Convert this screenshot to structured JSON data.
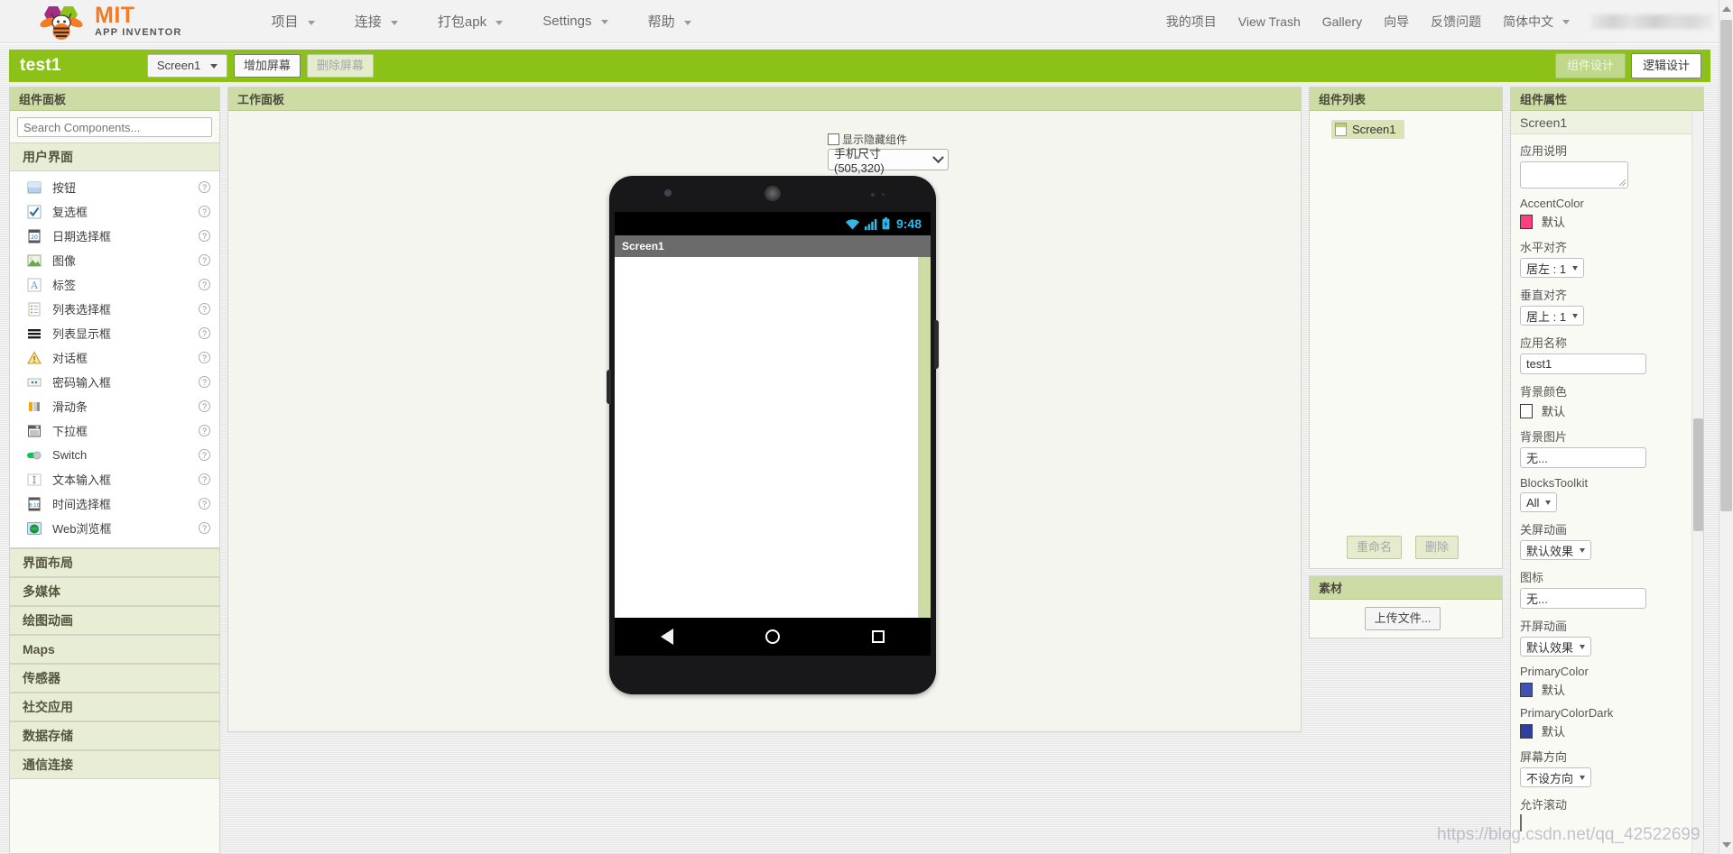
{
  "app": {
    "logo_mit": "MIT",
    "logo_subtitle": "APP INVENTOR",
    "logo_icon": "bee-logo-icon"
  },
  "topbar": {
    "menus": [
      {
        "label": "项目",
        "has_caret": true
      },
      {
        "label": "连接",
        "has_caret": true
      },
      {
        "label": "打包apk",
        "has_caret": true
      },
      {
        "label": "Settings",
        "has_caret": true
      },
      {
        "label": "帮助",
        "has_caret": true
      }
    ],
    "right_menus": [
      {
        "label": "我的项目",
        "has_caret": false
      },
      {
        "label": "View Trash",
        "has_caret": false
      },
      {
        "label": "Gallery",
        "has_caret": false
      },
      {
        "label": "向导",
        "has_caret": false
      },
      {
        "label": "反馈问题",
        "has_caret": false
      },
      {
        "label": "简体中文",
        "has_caret": true
      }
    ],
    "account_redacted": ""
  },
  "projectbar": {
    "project_name": "test1",
    "screen_selector": "Screen1",
    "add_screen": "增加屏幕",
    "remove_screen": "删除屏幕",
    "designer_toggle": "组件设计",
    "blocks_toggle": "逻辑设计",
    "active_toggle": "blocks"
  },
  "palette": {
    "header": "组件面板",
    "search_placeholder": "Search Components...",
    "search_value": "",
    "open_category": "用户界面",
    "categories": [
      {
        "label": "用户界面",
        "open": true,
        "items": [
          {
            "label": "按钮",
            "icon": "button-icon",
            "help": "?"
          },
          {
            "label": "复选框",
            "icon": "checkbox-icon",
            "help": "?"
          },
          {
            "label": "日期选择框",
            "icon": "datepicker-icon",
            "help": "?"
          },
          {
            "label": "图像",
            "icon": "image-icon",
            "help": "?"
          },
          {
            "label": "标签",
            "icon": "label-icon",
            "help": "?"
          },
          {
            "label": "列表选择框",
            "icon": "listpicker-icon",
            "help": "?"
          },
          {
            "label": "列表显示框",
            "icon": "listview-icon",
            "help": "?"
          },
          {
            "label": "对话框",
            "icon": "notifier-icon",
            "help": "?"
          },
          {
            "label": "密码输入框",
            "icon": "passwordbox-icon",
            "help": "?"
          },
          {
            "label": "滑动条",
            "icon": "slider-icon",
            "help": "?"
          },
          {
            "label": "下拉框",
            "icon": "spinner-icon",
            "help": "?"
          },
          {
            "label": "Switch",
            "icon": "switch-icon",
            "help": "?"
          },
          {
            "label": "文本输入框",
            "icon": "textbox-icon",
            "help": "?"
          },
          {
            "label": "时间选择框",
            "icon": "timepicker-icon",
            "help": "?"
          },
          {
            "label": "Web浏览框",
            "icon": "webviewer-icon",
            "help": "?"
          }
        ]
      },
      {
        "label": "界面布局",
        "open": false,
        "items": []
      },
      {
        "label": "多媒体",
        "open": false,
        "items": []
      },
      {
        "label": "绘图动画",
        "open": false,
        "items": []
      },
      {
        "label": "Maps",
        "open": false,
        "items": []
      },
      {
        "label": "传感器",
        "open": false,
        "items": []
      },
      {
        "label": "社交应用",
        "open": false,
        "items": []
      },
      {
        "label": "数据存储",
        "open": false,
        "items": []
      },
      {
        "label": "通信连接",
        "open": false,
        "items": []
      }
    ]
  },
  "viewer": {
    "header": "工作面板",
    "show_hidden_label": "显示隐藏组件",
    "show_hidden_checked": false,
    "size_preset": "手机尺寸 (505,320)",
    "phone": {
      "status_time": "9:48",
      "status_icons": [
        "wifi-icon",
        "signal-icon",
        "battery-icon"
      ],
      "title_bar_text": "Screen1",
      "nav_buttons": [
        "back-nav-icon",
        "home-nav-icon",
        "recent-nav-icon"
      ]
    }
  },
  "components": {
    "header": "组件列表",
    "tree": [
      {
        "label": "Screen1",
        "icon": "screen-icon",
        "selected": true
      }
    ],
    "rename_button": "重命名",
    "delete_button": "删除"
  },
  "media": {
    "header": "素材",
    "upload_button": "上传文件..."
  },
  "propertiesPanel": {
    "header": "组件属性",
    "selected_component": "Screen1",
    "properties": [
      {
        "name": "应用说明",
        "type": "textarea",
        "value": ""
      },
      {
        "name": "AccentColor",
        "type": "color",
        "value": "默认",
        "color": "#FF3F7F"
      },
      {
        "name": "水平对齐",
        "type": "dropdown",
        "value": "居左 : 1"
      },
      {
        "name": "垂直对齐",
        "type": "dropdown",
        "value": "居上 : 1"
      },
      {
        "name": "应用名称",
        "type": "text",
        "value": "test1"
      },
      {
        "name": "背景颜色",
        "type": "color",
        "value": "默认",
        "color": "#FFFFFF"
      },
      {
        "name": "背景图片",
        "type": "text",
        "value": "无..."
      },
      {
        "name": "BlocksToolkit",
        "type": "dropdown",
        "value": "All"
      },
      {
        "name": "关屏动画",
        "type": "dropdown",
        "value": "默认效果"
      },
      {
        "name": "图标",
        "type": "text",
        "value": "无..."
      },
      {
        "name": "开屏动画",
        "type": "dropdown",
        "value": "默认效果"
      },
      {
        "name": "PrimaryColor",
        "type": "color",
        "value": "默认",
        "color": "#3F51B5"
      },
      {
        "name": "PrimaryColorDark",
        "type": "color",
        "value": "默认",
        "color": "#303F9F"
      },
      {
        "name": "屏幕方向",
        "type": "dropdown",
        "value": "不设方向"
      },
      {
        "name": "允许滚动",
        "type": "checkbox",
        "value": ""
      }
    ]
  },
  "watermark": {
    "text": "https://blog.csdn.net/qq_42522699"
  },
  "theme": {
    "brand_green": "#8cc117",
    "panel_header_green": "#cddba5",
    "accent_pink": "#FF3F7F",
    "primary_blue": "#3F51B5",
    "status_blue": "#33b5e5"
  }
}
